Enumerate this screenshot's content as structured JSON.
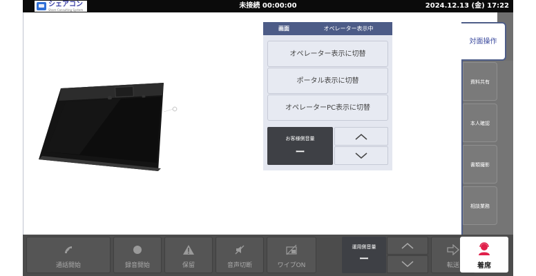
{
  "app": {
    "logo_name": "シェアコン",
    "logo_sub": "Share Consulting System"
  },
  "status": {
    "connection": "未接続 00:00:00",
    "datetime": "2024.12.13 (金) 17:22"
  },
  "panel": {
    "header_left": "画面",
    "header_right": "オペレーター表示中",
    "buttons": [
      "オペレーター表示に切替",
      "ポータル表示に切替",
      "オペレーターPC表示に切替"
    ],
    "volume_label": "お客様側音量",
    "volume_value": "ー"
  },
  "sidebar": {
    "active_tab": "対面操作",
    "tabs": [
      "資料共有",
      "本人確認",
      "書類撮影",
      "相談業務"
    ]
  },
  "toolbar": {
    "buttons": [
      {
        "label": "通話開始",
        "icon": "phone-icon"
      },
      {
        "label": "録音開始",
        "icon": "record-dot-icon"
      },
      {
        "label": "保留",
        "icon": "warning-icon"
      },
      {
        "label": "音声切断",
        "icon": "mute-icon"
      },
      {
        "label": "ワイプON",
        "icon": "wipe-icon"
      }
    ],
    "volume_label": "運用側音量",
    "volume_value": "ー",
    "transfer_label": "転送",
    "seat_label": "着席"
  },
  "colors": {
    "accent": "#4d5c87",
    "seat_icon": "#e0204a"
  }
}
